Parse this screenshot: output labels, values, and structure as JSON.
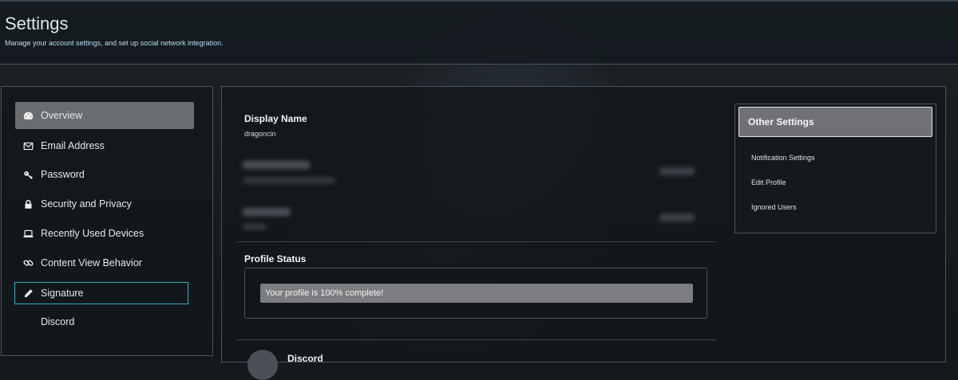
{
  "header": {
    "title": "Settings",
    "subtitle": "Manage your account settings, and set up social network integration."
  },
  "sidebar": {
    "items": [
      {
        "label": "Overview",
        "icon": "dashboard-icon"
      },
      {
        "label": "Email Address",
        "icon": "envelope-icon"
      },
      {
        "label": "Password",
        "icon": "key-icon"
      },
      {
        "label": "Security and Privacy",
        "icon": "lock-icon"
      },
      {
        "label": "Recently Used Devices",
        "icon": "laptop-icon"
      },
      {
        "label": "Content View Behavior",
        "icon": "link-icon"
      },
      {
        "label": "Signature",
        "icon": "pencil-icon"
      },
      {
        "label": "Discord",
        "icon": ""
      }
    ],
    "active": "Overview",
    "focused": "Signature"
  },
  "main": {
    "display_name": {
      "label": "Display Name",
      "value": "dragoncin"
    },
    "profile_status": {
      "label": "Profile Status",
      "message": "Your profile is 100% complete!",
      "progress": 100
    },
    "discord": {
      "label": "Discord"
    }
  },
  "other_settings": {
    "title": "Other Settings",
    "links": [
      "Notification Settings",
      "Edit Profile",
      "Ignored Users"
    ]
  },
  "colors": {
    "accent_focus": "#2bb3c9",
    "subtitle_blue": "#b8dff5",
    "active_item": "#6a6d70"
  }
}
